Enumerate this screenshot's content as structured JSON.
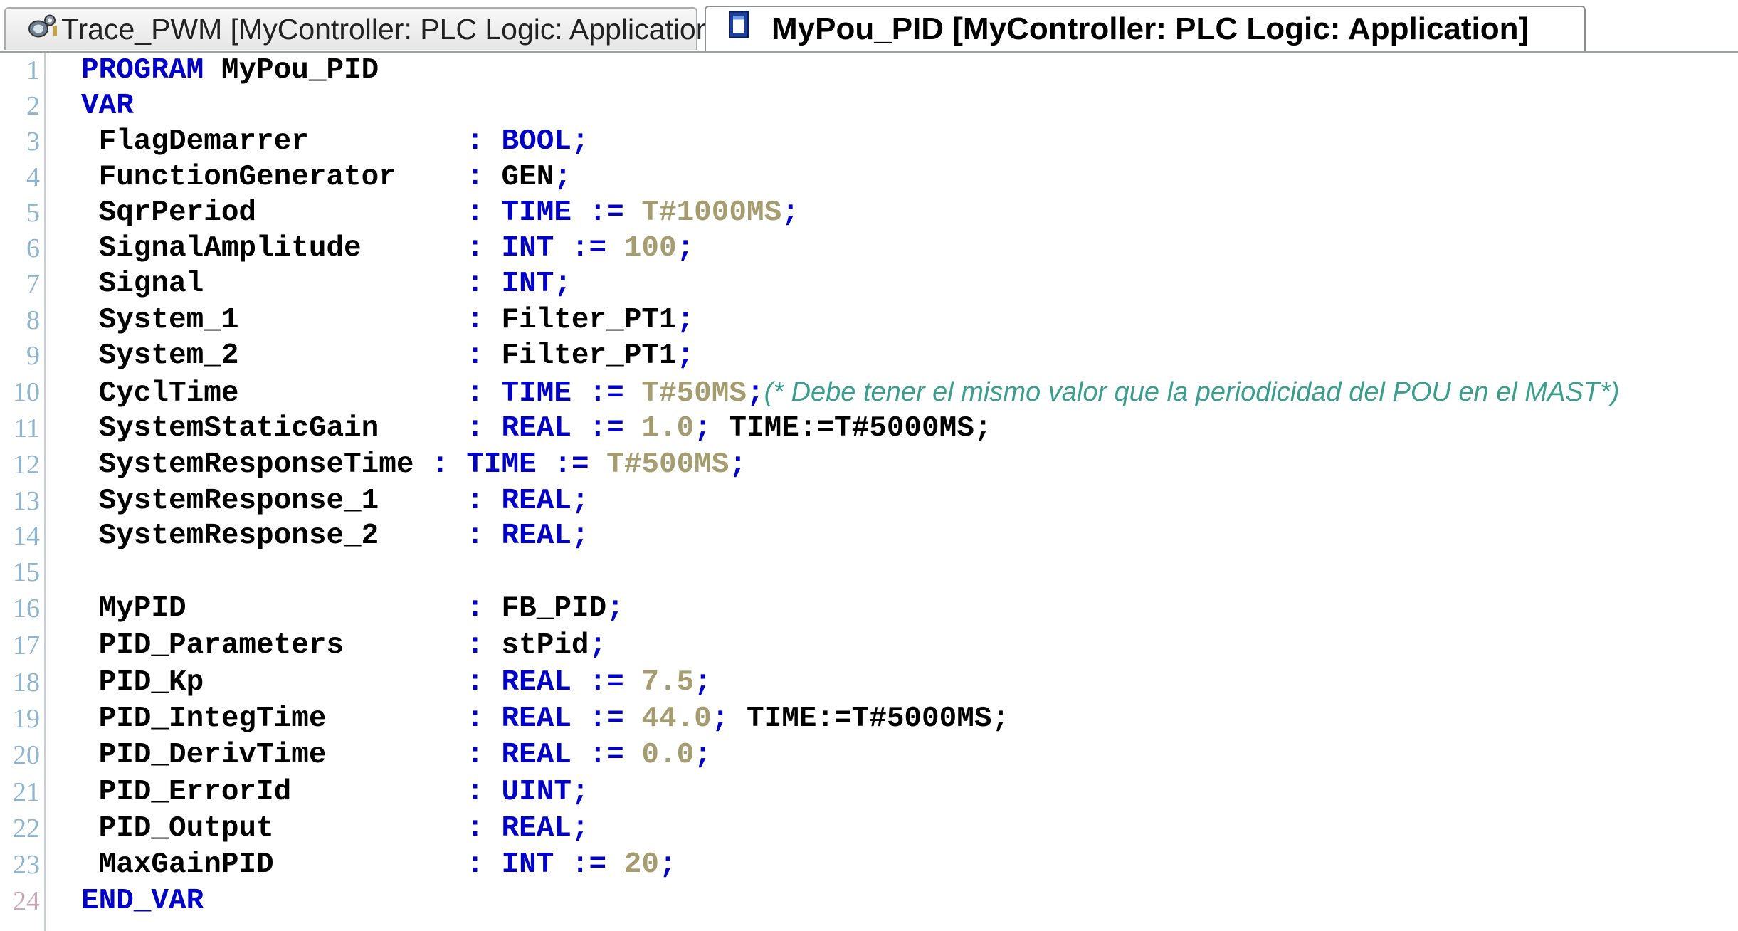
{
  "tabs": [
    {
      "label": "Trace_PWM [MyController: PLC Logic: Application]",
      "icon": "trace-icon"
    },
    {
      "label": "MyPou_PID [MyController: PLC Logic: Application]",
      "icon": "pou-document-icon"
    }
  ],
  "code": {
    "lines": [
      {
        "n": "1",
        "tokens": [
          {
            "t": "PROGRAM",
            "c": "kw"
          },
          {
            "t": " MyPou_PID",
            "c": ""
          }
        ]
      },
      {
        "n": "2",
        "tokens": [
          {
            "t": "VAR",
            "c": "kw"
          }
        ]
      },
      {
        "n": "3",
        "tokens": [
          {
            "t": " FlagDemarrer         ",
            "c": ""
          },
          {
            "t": ": ",
            "c": "punct"
          },
          {
            "t": "BOOL",
            "c": "kw"
          },
          {
            "t": ";",
            "c": "punct"
          }
        ]
      },
      {
        "n": "4",
        "tokens": [
          {
            "t": " FunctionGenerator    ",
            "c": ""
          },
          {
            "t": ": ",
            "c": "punct"
          },
          {
            "t": "GEN",
            "c": ""
          },
          {
            "t": ";",
            "c": "punct"
          }
        ]
      },
      {
        "n": "5",
        "tokens": [
          {
            "t": " SqrPeriod            ",
            "c": ""
          },
          {
            "t": ": ",
            "c": "punct"
          },
          {
            "t": "TIME",
            "c": "kw"
          },
          {
            "t": " := ",
            "c": "punct"
          },
          {
            "t": "T#1000MS",
            "c": "num"
          },
          {
            "t": ";",
            "c": "punct"
          }
        ]
      },
      {
        "n": "6",
        "tokens": [
          {
            "t": " SignalAmplitude      ",
            "c": ""
          },
          {
            "t": ": ",
            "c": "punct"
          },
          {
            "t": "INT",
            "c": "kw"
          },
          {
            "t": " := ",
            "c": "punct"
          },
          {
            "t": "100",
            "c": "num"
          },
          {
            "t": ";",
            "c": "punct"
          }
        ]
      },
      {
        "n": "7",
        "tokens": [
          {
            "t": " Signal               ",
            "c": ""
          },
          {
            "t": ": ",
            "c": "punct"
          },
          {
            "t": "INT",
            "c": "kw"
          },
          {
            "t": ";",
            "c": "punct"
          }
        ]
      },
      {
        "n": "8",
        "tokens": [
          {
            "t": " System_1             ",
            "c": ""
          },
          {
            "t": ": ",
            "c": "punct"
          },
          {
            "t": "Filter_PT1",
            "c": ""
          },
          {
            "t": ";",
            "c": "punct"
          }
        ]
      },
      {
        "n": "9",
        "tokens": [
          {
            "t": " System_2             ",
            "c": ""
          },
          {
            "t": ": ",
            "c": "punct"
          },
          {
            "t": "Filter_PT1",
            "c": ""
          },
          {
            "t": ";",
            "c": "punct"
          }
        ]
      },
      {
        "n": "10",
        "tokens": [
          {
            "t": " CyclTime             ",
            "c": ""
          },
          {
            "t": ": ",
            "c": "punct"
          },
          {
            "t": "TIME",
            "c": "kw"
          },
          {
            "t": " := ",
            "c": "punct"
          },
          {
            "t": "T#50MS",
            "c": "num"
          },
          {
            "t": ";",
            "c": "punct"
          },
          {
            "t": "(* Debe tener el mismo valor que la periodicidad del POU en el MAST*)",
            "c": "comment"
          }
        ]
      },
      {
        "n": "11",
        "tokens": [
          {
            "t": " SystemStaticGain     ",
            "c": ""
          },
          {
            "t": ": ",
            "c": "punct"
          },
          {
            "t": "REAL",
            "c": "kw"
          },
          {
            "t": " := ",
            "c": "punct"
          },
          {
            "t": "1.0",
            "c": "num"
          },
          {
            "t": "; ",
            "c": "punct"
          },
          {
            "t": "TIME:=T#5000MS;",
            "c": ""
          }
        ]
      },
      {
        "n": "12",
        "tokens": [
          {
            "t": " SystemResponseTime ",
            "c": ""
          },
          {
            "t": ": ",
            "c": "punct"
          },
          {
            "t": "TIME",
            "c": "kw"
          },
          {
            "t": " := ",
            "c": "punct"
          },
          {
            "t": "T#500MS",
            "c": "num"
          },
          {
            "t": ";",
            "c": "punct"
          }
        ]
      },
      {
        "n": "13",
        "tokens": [
          {
            "t": " SystemResponse_1     ",
            "c": ""
          },
          {
            "t": ": ",
            "c": "punct"
          },
          {
            "t": "REAL",
            "c": "kw"
          },
          {
            "t": ";",
            "c": "punct"
          }
        ]
      },
      {
        "n": "14",
        "tokens": [
          {
            "t": " SystemResponse_2     ",
            "c": ""
          },
          {
            "t": ": ",
            "c": "punct"
          },
          {
            "t": "REAL",
            "c": "kw"
          },
          {
            "t": ";",
            "c": "punct"
          }
        ]
      },
      {
        "n": "15",
        "tokens": []
      },
      {
        "n": "16",
        "tokens": [
          {
            "t": " MyPID                ",
            "c": ""
          },
          {
            "t": ": ",
            "c": "punct"
          },
          {
            "t": "FB_PID",
            "c": ""
          },
          {
            "t": ";",
            "c": "punct"
          }
        ]
      },
      {
        "n": "17",
        "tokens": [
          {
            "t": " PID_Parameters       ",
            "c": ""
          },
          {
            "t": ": ",
            "c": "punct"
          },
          {
            "t": "stPid",
            "c": ""
          },
          {
            "t": ";",
            "c": "punct"
          }
        ]
      },
      {
        "n": "18",
        "tokens": [
          {
            "t": " PID_Kp               ",
            "c": ""
          },
          {
            "t": ": ",
            "c": "punct"
          },
          {
            "t": "REAL",
            "c": "kw"
          },
          {
            "t": " := ",
            "c": "punct"
          },
          {
            "t": "7.5",
            "c": "num"
          },
          {
            "t": ";",
            "c": "punct"
          }
        ]
      },
      {
        "n": "19",
        "tokens": [
          {
            "t": " PID_IntegTime        ",
            "c": ""
          },
          {
            "t": ": ",
            "c": "punct"
          },
          {
            "t": "REAL",
            "c": "kw"
          },
          {
            "t": " := ",
            "c": "punct"
          },
          {
            "t": "44.0",
            "c": "num"
          },
          {
            "t": "; ",
            "c": "punct"
          },
          {
            "t": "TIME:=T#5000MS;",
            "c": ""
          }
        ]
      },
      {
        "n": "20",
        "tokens": [
          {
            "t": " PID_DerivTime        ",
            "c": ""
          },
          {
            "t": ": ",
            "c": "punct"
          },
          {
            "t": "REAL",
            "c": "kw"
          },
          {
            "t": " := ",
            "c": "punct"
          },
          {
            "t": "0.0",
            "c": "num"
          },
          {
            "t": ";",
            "c": "punct"
          }
        ]
      },
      {
        "n": "21",
        "tokens": [
          {
            "t": " PID_ErrorId          ",
            "c": ""
          },
          {
            "t": ": ",
            "c": "punct"
          },
          {
            "t": "UINT",
            "c": "kw"
          },
          {
            "t": ";",
            "c": "punct"
          }
        ]
      },
      {
        "n": "22",
        "tokens": [
          {
            "t": " PID_Output           ",
            "c": ""
          },
          {
            "t": ": ",
            "c": "punct"
          },
          {
            "t": "REAL",
            "c": "kw"
          },
          {
            "t": ";",
            "c": "punct"
          }
        ]
      },
      {
        "n": "23",
        "tokens": [
          {
            "t": " MaxGainPID           ",
            "c": ""
          },
          {
            "t": ": ",
            "c": "punct"
          },
          {
            "t": "INT",
            "c": "kw"
          },
          {
            "t": " := ",
            "c": "punct"
          },
          {
            "t": "20",
            "c": "num"
          },
          {
            "t": ";",
            "c": "punct"
          }
        ]
      },
      {
        "n": "24",
        "tokens": [
          {
            "t": "END_VAR",
            "c": "kw"
          }
        ]
      }
    ]
  },
  "colors": {
    "keyword": "#0000c8",
    "literal": "#a59d6f",
    "comment": "#3a9e8e",
    "line_number": "#8db5d1"
  }
}
